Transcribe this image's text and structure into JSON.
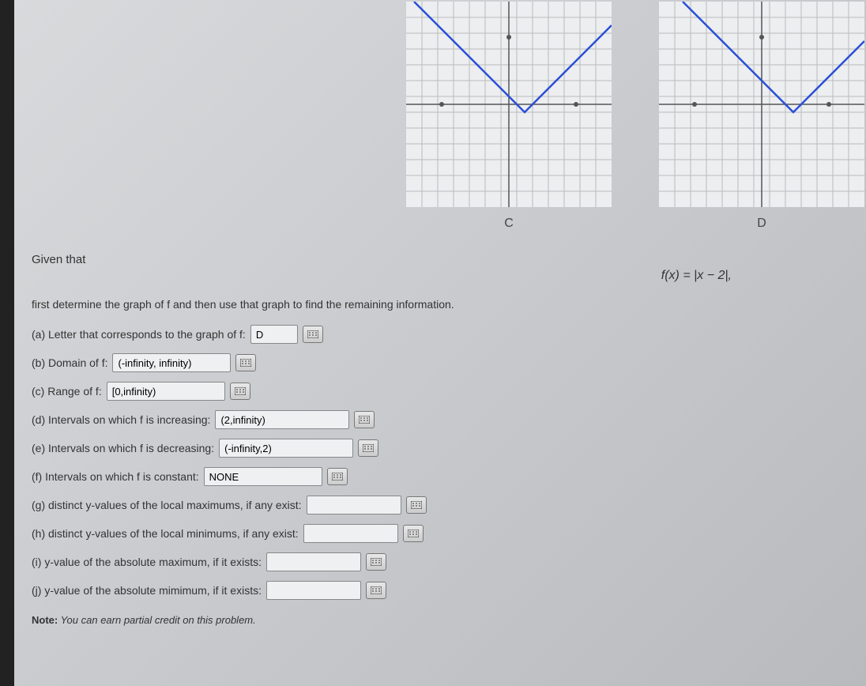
{
  "graphs": {
    "c_label": "C",
    "d_label": "D"
  },
  "chart_data": [
    {
      "type": "line",
      "label": "C",
      "xlim": [
        -7,
        7
      ],
      "ylim": [
        -7,
        7
      ],
      "series": [
        {
          "name": "f",
          "points": [
            [
              -6,
              7
            ],
            [
              1,
              0
            ],
            [
              7,
              6
            ]
          ]
        }
      ],
      "grid": true,
      "description": "V-shape with vertex at (1,0)"
    },
    {
      "type": "line",
      "label": "D",
      "xlim": [
        -7,
        7
      ],
      "ylim": [
        -7,
        7
      ],
      "series": [
        {
          "name": "f",
          "points": [
            [
              -5,
              7
            ],
            [
              2,
              0
            ],
            [
              7,
              5
            ]
          ]
        }
      ],
      "grid": true,
      "description": "V-shape with vertex at (2,0)"
    }
  ],
  "text": {
    "given": "Given that",
    "formula_lhs": "f(x) = ",
    "formula_rhs": "|x − 2|,",
    "instruction": "first determine the graph of f and then use that graph to find the remaining information.",
    "a": "(a) Letter that corresponds to the graph of f:",
    "b": "(b) Domain of f:",
    "c": "(c) Range of f:",
    "d": "(d) Intervals on which f is increasing:",
    "e": "(e) Intervals on which f is decreasing:",
    "f": "(f) Intervals on which f is constant:",
    "g": "(g) distinct y-values of the local maximums, if any exist:",
    "h": "(h) distinct y-values of the local minimums, if any exist:",
    "i": "(i) y-value of the absolute maximum, if it exists:",
    "j": "(j) y-value of the absolute mimimum, if it exists:",
    "note_bold": "Note:",
    "note_rest": " You can earn partial credit on this problem."
  },
  "answers": {
    "a": "D",
    "b": "(-infinity, infinity)",
    "c": "[0,infinity)",
    "d": "(2,infinity)",
    "e": "(-infinity,2)",
    "f": "NONE",
    "g": "",
    "h": "",
    "i": "",
    "j": ""
  }
}
